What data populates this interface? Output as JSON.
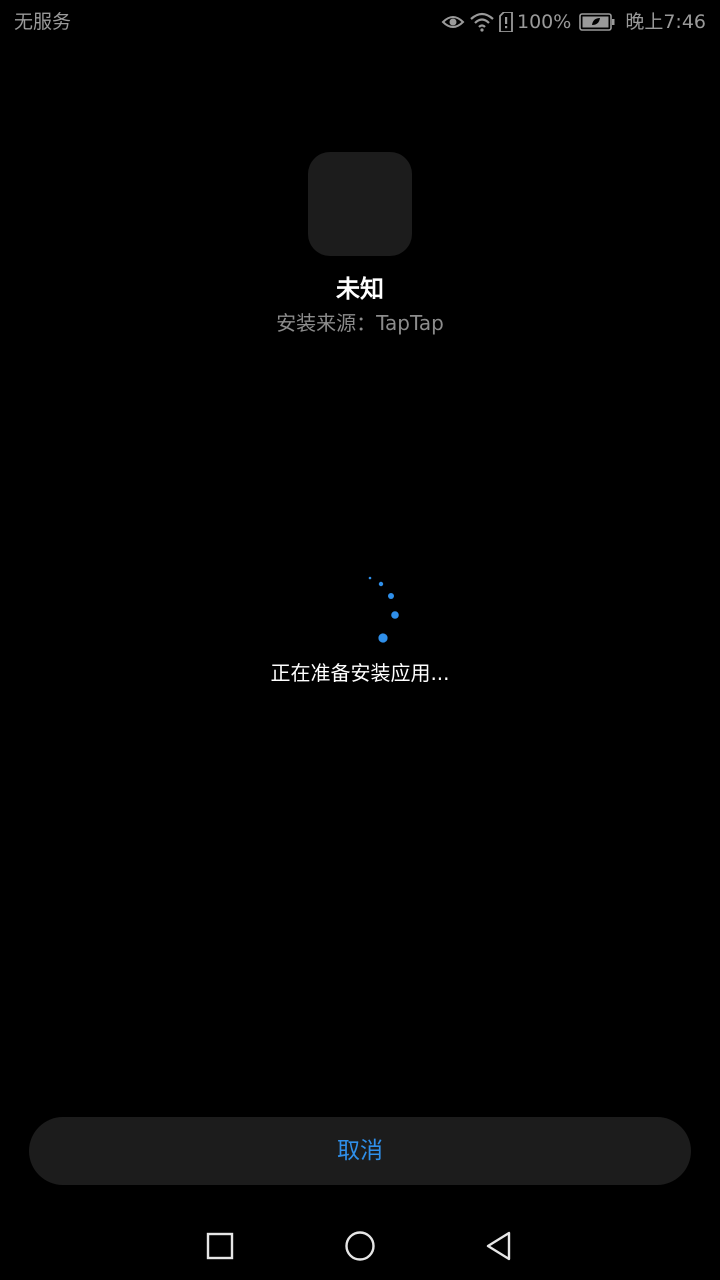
{
  "status_bar": {
    "carrier": "无服务",
    "battery_percent": "100%",
    "time": "晚上7:46",
    "icons": [
      "eye-icon",
      "wifi-icon",
      "sim-alert-icon",
      "battery-icon"
    ]
  },
  "app": {
    "name": "未知",
    "install_source": "安装来源：TapTap"
  },
  "loading": {
    "message": "正在准备安装应用..."
  },
  "actions": {
    "cancel_label": "取消"
  },
  "nav_bar": {
    "buttons": [
      "recent-apps-icon",
      "home-icon",
      "back-icon"
    ]
  },
  "colors": {
    "background": "#000000",
    "accent": "#2f8fea",
    "surface": "#1c1c1c",
    "secondary_text": "#8c8c8c"
  }
}
